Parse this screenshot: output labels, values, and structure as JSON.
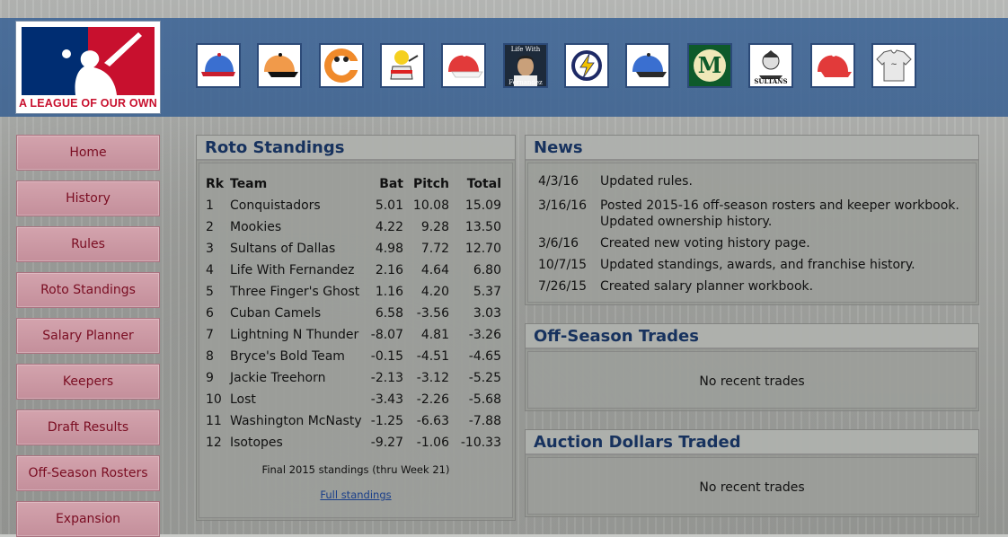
{
  "header": {
    "logo_text": "A LEAGUE OF OUR OWN",
    "team_icons": [
      {
        "icon": "blue-cap-icon"
      },
      {
        "icon": "orange-cap-icon"
      },
      {
        "icon": "camel-logo-icon"
      },
      {
        "icon": "cartoon-mascot-icon"
      },
      {
        "icon": "red-cap-icon"
      },
      {
        "icon": "life-with-fernandez-photo",
        "label_top": "Life With",
        "label_bottom": "Fernandez"
      },
      {
        "icon": "lightning-logo-icon"
      },
      {
        "icon": "blue-cap-icon"
      },
      {
        "icon": "green-m-logo-icon"
      },
      {
        "icon": "sultans-logo-icon",
        "label": "SULTANS"
      },
      {
        "icon": "red-cap-icon"
      },
      {
        "icon": "jersey-icon"
      }
    ]
  },
  "sidebar": {
    "items": [
      {
        "label": "Home"
      },
      {
        "label": "History"
      },
      {
        "label": "Rules"
      },
      {
        "label": "Roto Standings"
      },
      {
        "label": "Salary Planner"
      },
      {
        "label": "Keepers"
      },
      {
        "label": "Draft Results"
      },
      {
        "label": "Off-Season Rosters"
      },
      {
        "label": "Expansion"
      }
    ]
  },
  "standings": {
    "title": "Roto Standings",
    "headers": {
      "rk": "Rk",
      "team": "Team",
      "bat": "Bat",
      "pitch": "Pitch",
      "total": "Total"
    },
    "rows": [
      {
        "rk": "1",
        "team": "Conquistadors",
        "bat": "5.01",
        "pitch": "10.08",
        "total": "15.09"
      },
      {
        "rk": "2",
        "team": "Mookies",
        "bat": "4.22",
        "pitch": "9.28",
        "total": "13.50"
      },
      {
        "rk": "3",
        "team": "Sultans of Dallas",
        "bat": "4.98",
        "pitch": "7.72",
        "total": "12.70"
      },
      {
        "rk": "4",
        "team": "Life With Fernandez",
        "bat": "2.16",
        "pitch": "4.64",
        "total": "6.80"
      },
      {
        "rk": "5",
        "team": "Three Finger's Ghost",
        "bat": "1.16",
        "pitch": "4.20",
        "total": "5.37"
      },
      {
        "rk": "6",
        "team": "Cuban Camels",
        "bat": "6.58",
        "pitch": "-3.56",
        "total": "3.03"
      },
      {
        "rk": "7",
        "team": "Lightning N Thunder",
        "bat": "-8.07",
        "pitch": "4.81",
        "total": "-3.26"
      },
      {
        "rk": "8",
        "team": "Bryce's Bold Team",
        "bat": "-0.15",
        "pitch": "-4.51",
        "total": "-4.65"
      },
      {
        "rk": "9",
        "team": "Jackie Treehorn",
        "bat": "-2.13",
        "pitch": "-3.12",
        "total": "-5.25"
      },
      {
        "rk": "10",
        "team": "Lost",
        "bat": "-3.43",
        "pitch": "-2.26",
        "total": "-5.68"
      },
      {
        "rk": "11",
        "team": "Washington McNasty",
        "bat": "-1.25",
        "pitch": "-6.63",
        "total": "-7.88"
      },
      {
        "rk": "12",
        "team": "Isotopes",
        "bat": "-9.27",
        "pitch": "-1.06",
        "total": "-10.33"
      }
    ],
    "footnote": "Final 2015 standings (thru Week 21)",
    "full_link": "Full standings"
  },
  "news": {
    "title": "News",
    "items": [
      {
        "date": "4/3/16",
        "text": "Updated rules."
      },
      {
        "date": "3/16/16",
        "text": "Posted 2015-16 off-season rosters and keeper workbook. Updated ownership history."
      },
      {
        "date": "3/6/16",
        "text": "Created new voting history page."
      },
      {
        "date": "10/7/15",
        "text": "Updated standings, awards, and franchise history."
      },
      {
        "date": "7/26/15",
        "text": "Created salary planner workbook."
      }
    ]
  },
  "offseason_trades": {
    "title": "Off-Season Trades",
    "empty_text": "No recent trades"
  },
  "auction_dollars": {
    "title": "Auction Dollars Traded",
    "empty_text": "No recent trades"
  },
  "colors": {
    "header_blue": "#3c6496",
    "nav_pink": "#c9979f",
    "nav_text": "#7a0d22",
    "panel_title": "#17325e",
    "logo_red": "#c8102e",
    "logo_blue": "#002d72"
  }
}
